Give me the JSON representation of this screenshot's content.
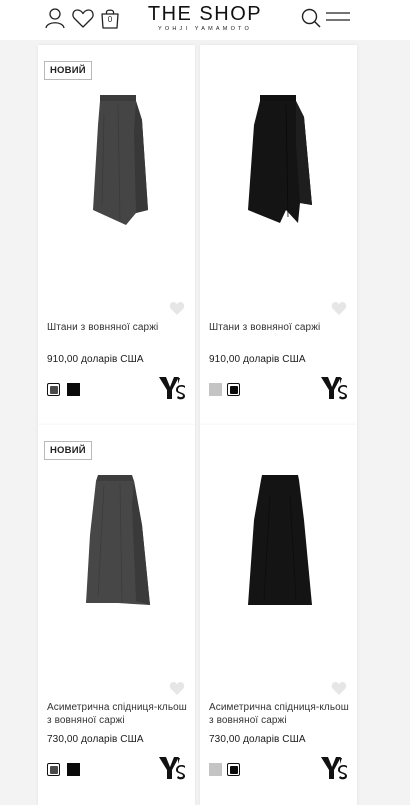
{
  "header": {
    "logo_title": "THE SHOP",
    "logo_subtitle": "YOHJI YAMAMOTO",
    "cart_count": "0",
    "icons": [
      "user-icon",
      "heart-icon",
      "shopping-bag-icon",
      "search-icon",
      "menu-icon"
    ]
  },
  "colors": {
    "charcoal_grey": "#4a4a4a",
    "light_grey": "#c4c4c4",
    "black": "#0a0a0a"
  },
  "products": [
    {
      "badge": "НОВИЙ",
      "name": "Штани з вовняної саржі",
      "price": "910,00 доларів США",
      "swatches": [
        {
          "color": "#4a4a4a",
          "selected": true
        },
        {
          "color": "#0a0a0a",
          "selected": false
        }
      ],
      "brand_logo": "Y's"
    },
    {
      "badge": "",
      "name": "Штани з вовняної саржі",
      "price": "910,00 доларів США",
      "swatches": [
        {
          "color": "#c4c4c4",
          "selected": false
        },
        {
          "color": "#0a0a0a",
          "selected": true
        }
      ],
      "brand_logo": "Y's"
    },
    {
      "badge": "НОВИЙ",
      "name": "Асиметрична спідниця-кльош з вовняної саржі",
      "price": "730,00 доларів США",
      "swatches": [
        {
          "color": "#4a4a4a",
          "selected": true
        },
        {
          "color": "#0a0a0a",
          "selected": false
        }
      ],
      "brand_logo": "Y's"
    },
    {
      "badge": "",
      "name": "Асиметрична спідниця-кльош з вовняної саржі",
      "price": "730,00 доларів США",
      "swatches": [
        {
          "color": "#c4c4c4",
          "selected": false
        },
        {
          "color": "#0a0a0a",
          "selected": true
        }
      ],
      "brand_logo": "Y's"
    }
  ]
}
